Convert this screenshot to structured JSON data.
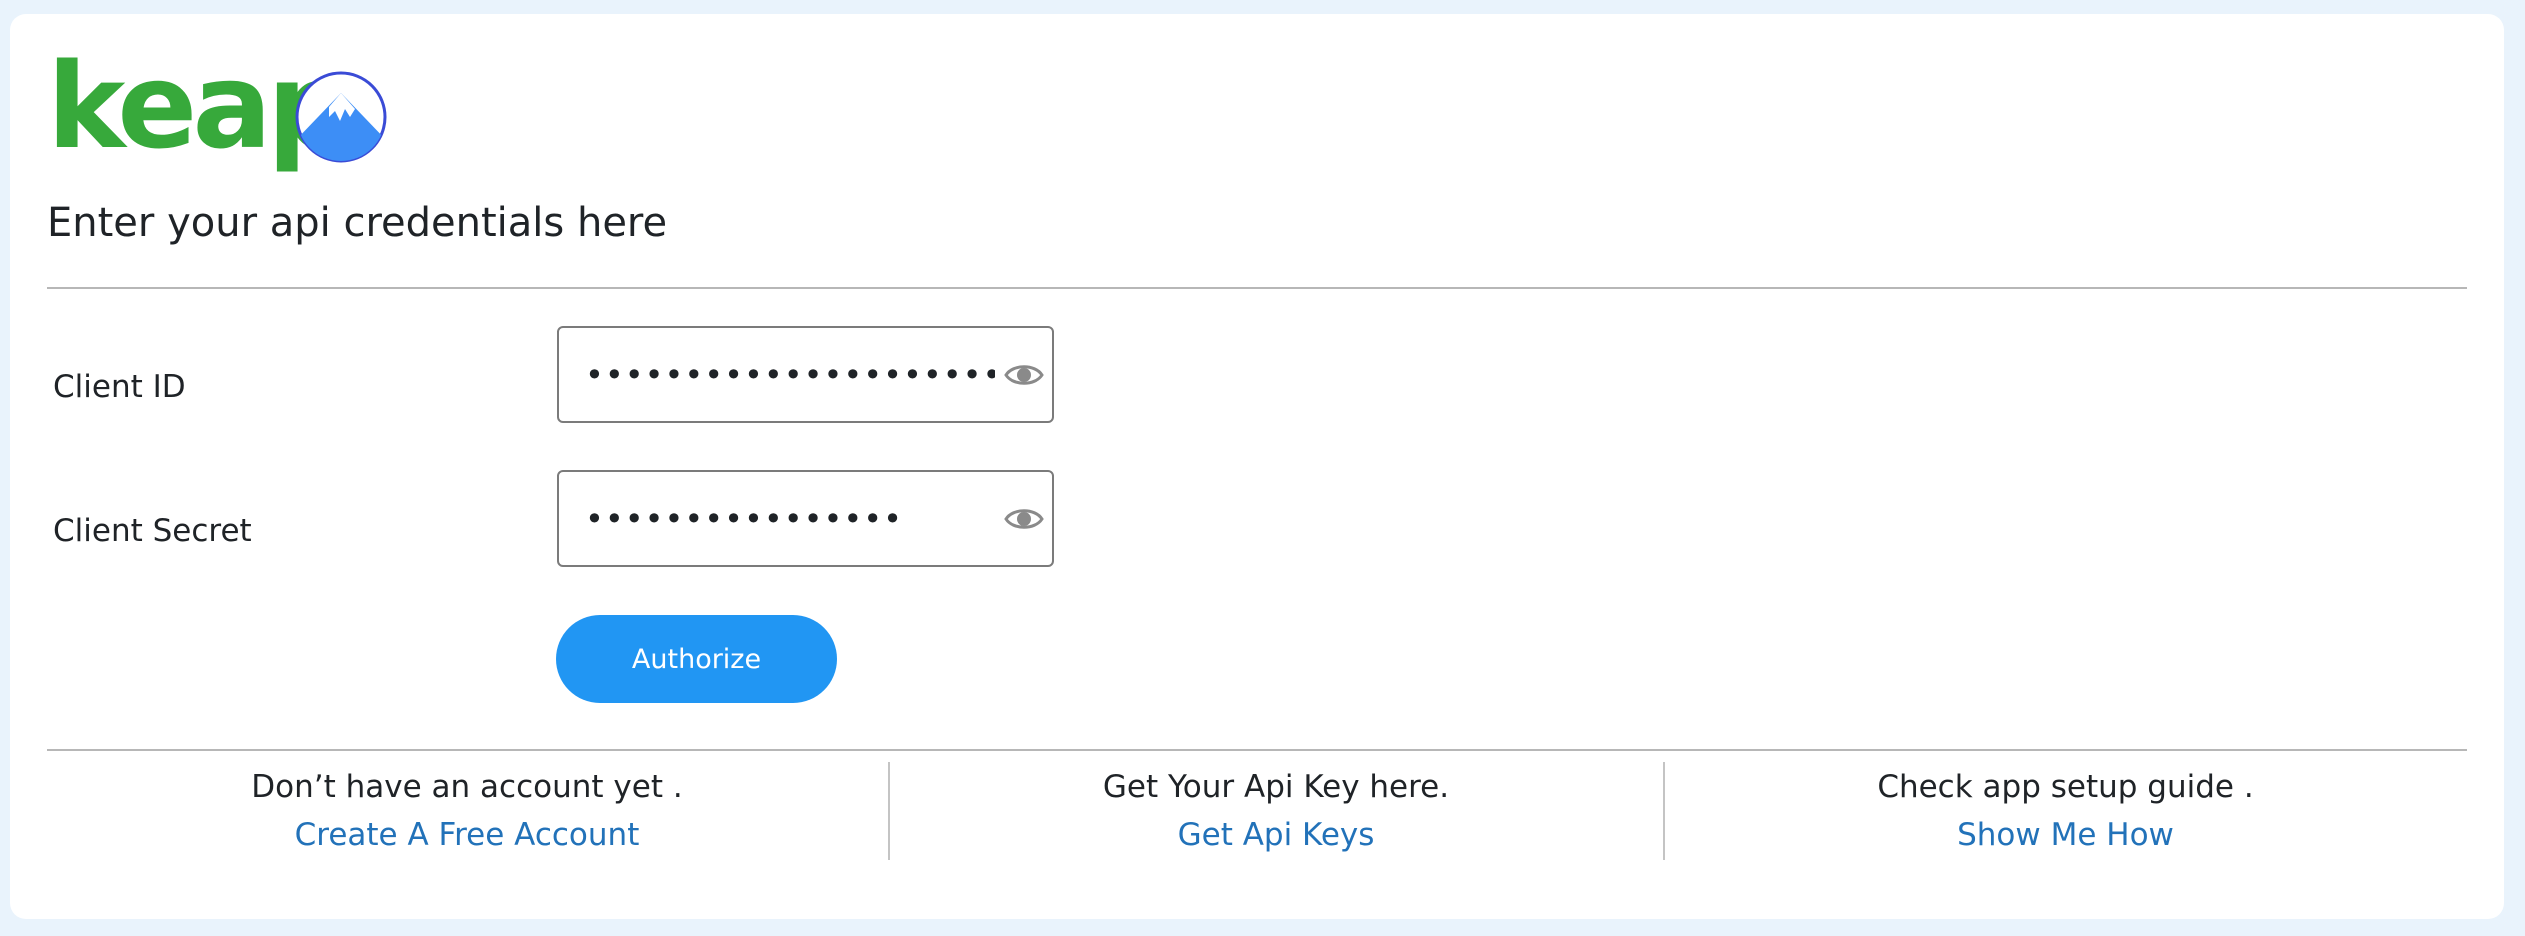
{
  "brand": {
    "wordmark": "keap"
  },
  "form": {
    "heading": "Enter your api credentials here",
    "client_id": {
      "label": "Client ID",
      "value": "••••••••••••••••••••••••••••••"
    },
    "client_secret": {
      "label": "Client Secret",
      "value": "••••••••••••••••"
    },
    "authorize_label": "Authorize"
  },
  "footer": {
    "col1": {
      "text": "Don’t have an account yet .",
      "link": "Create A Free Account"
    },
    "col2": {
      "text": "Get Your Api Key here.",
      "link": "Get Api Keys"
    },
    "col3": {
      "text": "Check app setup guide .",
      "link": "Show Me How"
    }
  },
  "colors": {
    "brand_green": "#37a93b",
    "primary_blue": "#2196f3",
    "link_blue": "#2272b9"
  },
  "icons": {
    "reveal": "eye-icon",
    "badge": "mountain-icon"
  }
}
